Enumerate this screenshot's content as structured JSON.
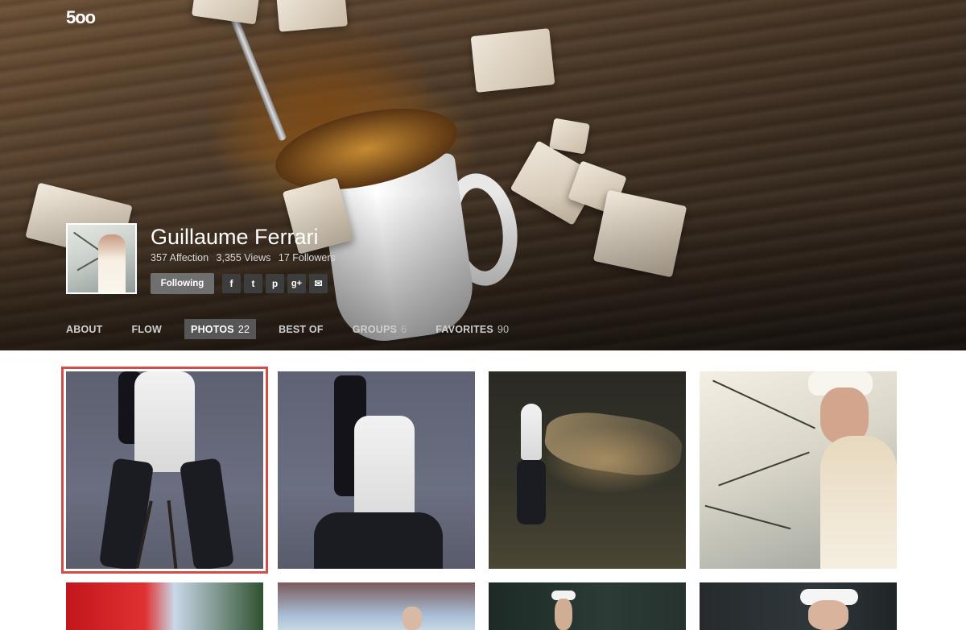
{
  "app": {
    "logo_text": "5oo"
  },
  "profile": {
    "name": "Guillaume Ferrari",
    "stats": [
      "357 Affection",
      "3,355 Views",
      "17 Followers"
    ],
    "follow_label": "Following"
  },
  "social_icons": [
    {
      "name": "facebook-icon",
      "glyph": "f"
    },
    {
      "name": "twitter-icon",
      "glyph": "t"
    },
    {
      "name": "pinterest-icon",
      "glyph": "p"
    },
    {
      "name": "google-plus-icon",
      "glyph": "g+"
    },
    {
      "name": "email-icon",
      "glyph": "✉"
    }
  ],
  "tabs": [
    {
      "label": "ABOUT",
      "count": ""
    },
    {
      "label": "FLOW",
      "count": ""
    },
    {
      "label": "PHOTOS",
      "count": "22",
      "active": true
    },
    {
      "label": "BEST OF",
      "count": ""
    },
    {
      "label": "GROUPS",
      "count": "6"
    },
    {
      "label": "FAVORITES",
      "count": "90"
    }
  ],
  "colors": {
    "selection_border": "#d14d45",
    "active_tab_bg": "#565656",
    "follow_button_bg": "#6f6f6f"
  }
}
